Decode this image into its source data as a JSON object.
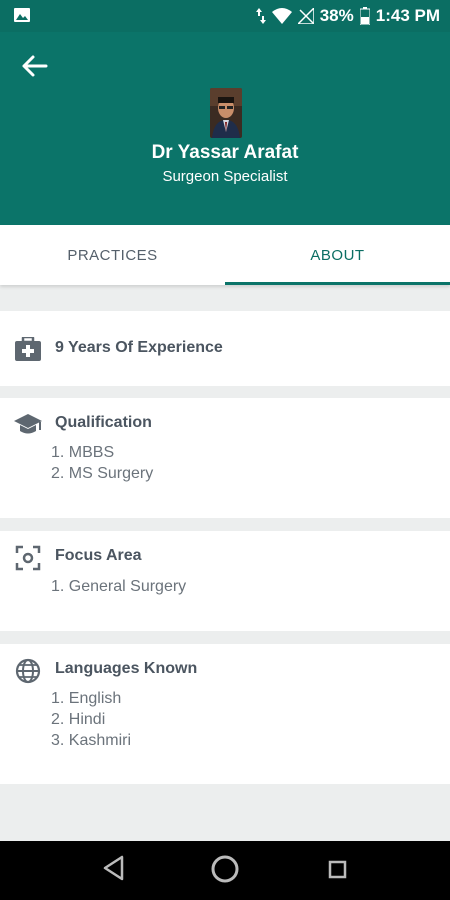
{
  "status_bar": {
    "battery": "38%",
    "time": "1:43 PM"
  },
  "header": {
    "doctor_name": "Dr Yassar Arafat",
    "specialty": "Surgeon Specialist"
  },
  "tabs": [
    {
      "label": "PRACTICES",
      "active": false
    },
    {
      "label": "ABOUT",
      "active": true
    }
  ],
  "experience": {
    "label": "9 Years Of Experience",
    "icon": "medical-bag-icon"
  },
  "qualification": {
    "title": "Qualification",
    "icon": "graduation-cap-icon",
    "items": [
      "1. MBBS",
      "2. MS Surgery"
    ]
  },
  "focus_area": {
    "title": "Focus Area",
    "icon": "focus-icon",
    "items": [
      "1. General Surgery"
    ]
  },
  "languages": {
    "title": "Languages Known",
    "icon": "globe-icon",
    "items": [
      "1. English",
      "2. Hindi",
      "3. Kashmiri"
    ]
  },
  "colors": {
    "primary": "#0b7469",
    "status_bar": "#0b6e63",
    "background": "#eceeee"
  }
}
